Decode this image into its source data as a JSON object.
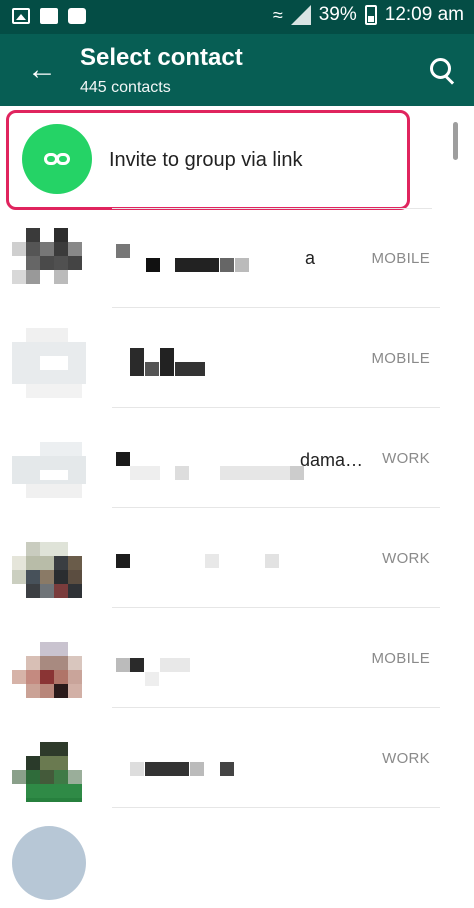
{
  "statusbar": {
    "battery": "39%",
    "time": "12:09 am"
  },
  "appbar": {
    "title": "Select contact",
    "subtitle": "445 contacts"
  },
  "invite": {
    "label": "Invite to group via link"
  },
  "contacts": [
    {
      "type": "MOBILE",
      "name_visible": "a"
    },
    {
      "type": "MOBILE"
    },
    {
      "type": "WORK",
      "name_visible": "dama…"
    },
    {
      "type": "WORK"
    },
    {
      "type": "MOBILE"
    },
    {
      "type": "WORK"
    }
  ],
  "colors": {
    "statusbar": "#044d45",
    "appbar": "#075e54",
    "accent": "#25d366",
    "highlight": "#e0245e"
  }
}
